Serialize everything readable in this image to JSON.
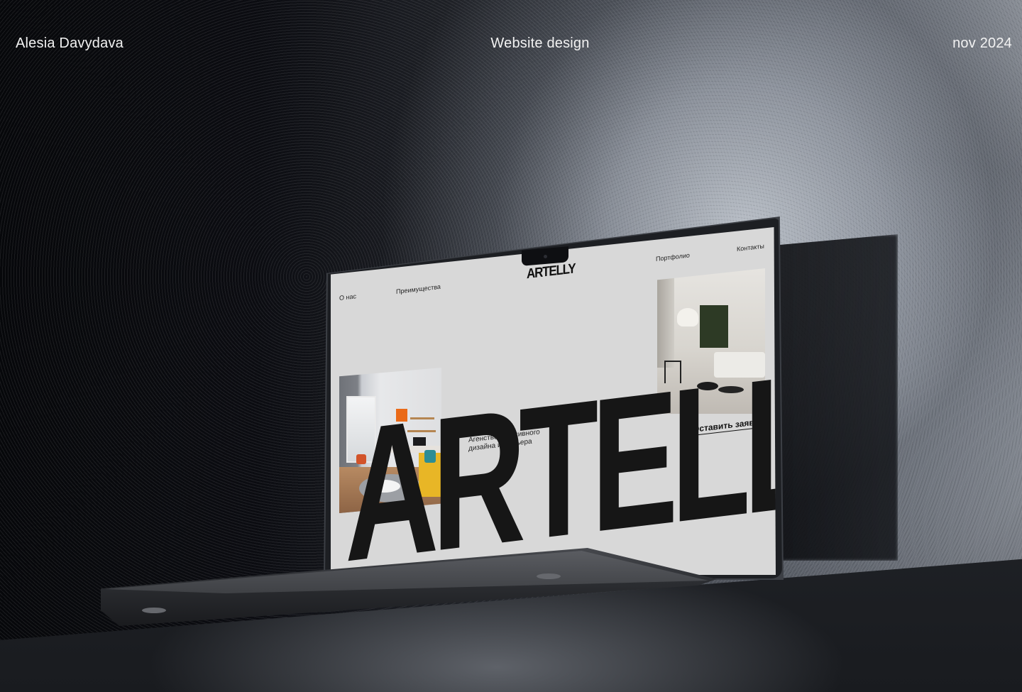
{
  "header": {
    "author": "Alesia Davydava",
    "project": "Website design",
    "date": "nov 2024"
  },
  "mockup_site": {
    "nav": {
      "about": "О нас",
      "advantages": "Преимущества",
      "portfolio": "Портфолио",
      "contacts": "Контакты"
    },
    "logo": "ARTELLY",
    "big_logo": "ARTELLY",
    "tagline": "Агенство креативного дизайна интерьера",
    "cta": "Оставить заявку !"
  },
  "colors": {
    "screen_bg": "#d8d8d8",
    "text": "#161616",
    "background": "#0b0c10"
  }
}
